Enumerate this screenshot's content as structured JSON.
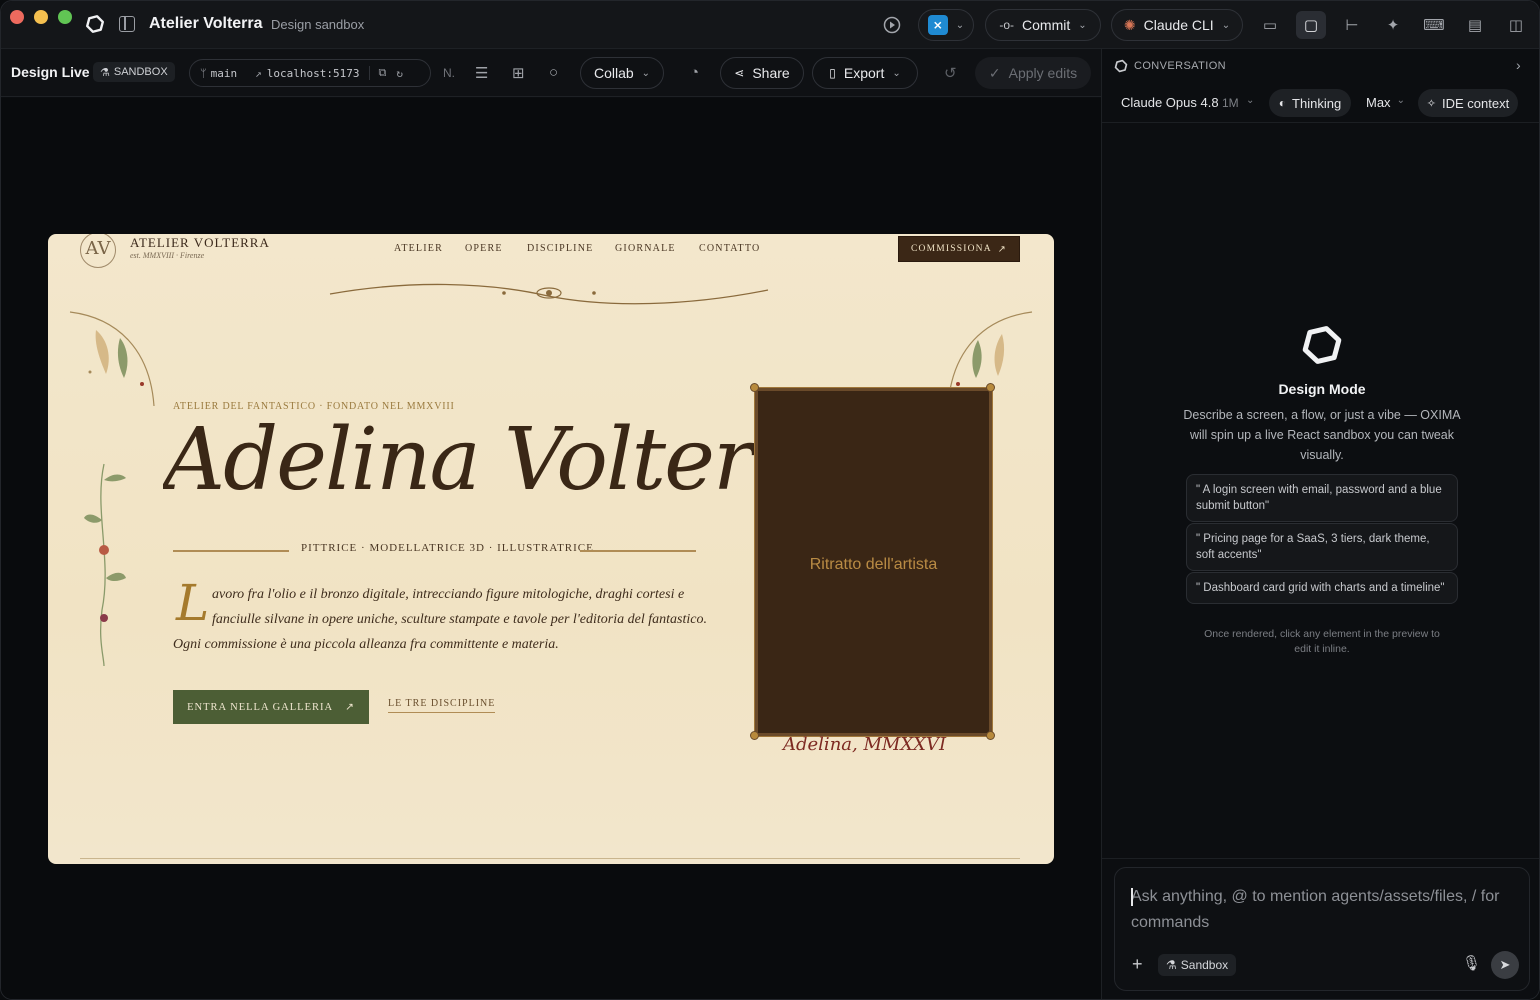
{
  "app": {
    "title": "Atelier Volterra",
    "subtitle": "Design sandbox"
  },
  "titlebar": {
    "commit_label": "Commit",
    "cli_label": "Claude CLI"
  },
  "toolbar": {
    "title": "Design Live",
    "badge": "SANDBOX",
    "branch": "main",
    "url": "localhost:5173",
    "n_label": "N.",
    "collab_label": "Collab",
    "share_label": "Share",
    "export_label": "Export",
    "apply_label": "Apply edits"
  },
  "preview": {
    "monogram": "AV",
    "brand": "ATELIER VOLTERRA",
    "est": "est. MMXVIII · Firenze",
    "nav": [
      "ATELIER",
      "OPERE",
      "DISCIPLINE",
      "GIORNALE",
      "CONTATTO"
    ],
    "commission_label": "COMMISSIONA",
    "eyebrow": "ATELIER DEL FANTASTICO · FONDATO NEL MMXVIII",
    "name": "Adelina Volterra",
    "roles": "PITTRICE · MODELLATRICE 3D · ILLUSTRATRICE",
    "dropcap": "L",
    "body_lines": [
      "avoro fra l'olio e il bronzo digitale, intrecciando figure mitologiche, draghi cortesi e",
      "fanciulle silvane in opere uniche, sculture stampate e tavole per l'editoria del fantastico.",
      "Ogni commissione è una piccola alleanza fra committente e materia."
    ],
    "cta_label": "ENTRA NELLA GALLERIA",
    "secondary_link": "LE TRE DISCIPLINE",
    "portrait_label": "Ritratto dell'artista",
    "signature": "Adelina, MMXXVI"
  },
  "panel": {
    "header": "CONVERSATION",
    "model": "Claude Opus 4.8",
    "model_tag": "1M",
    "thinking_label": "Thinking",
    "effort_label": "Max",
    "context_label": "IDE context",
    "mode_title": "Design Mode",
    "mode_desc": "Describe a screen, a flow, or just a vibe — OXIMA will spin up a live React sandbox you can tweak visually.",
    "suggestions": [
      "\" A login screen with email, password and a blue submit button\"",
      "\" Pricing page for a SaaS, 3 tiers, dark theme, soft accents\"",
      "\" Dashboard card grid with charts and a timeline\""
    ],
    "footnote": "Once rendered, click any element in the preview to edit it inline.",
    "composer_placeholder": "Ask anything, @ to mention agents/assets/files, / for commands",
    "sandbox_chip": "Sandbox"
  }
}
